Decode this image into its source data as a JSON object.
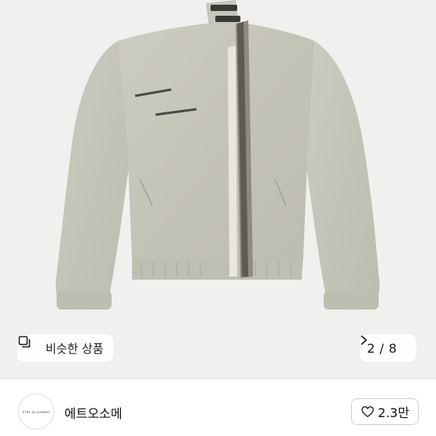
{
  "product_image": {
    "background": "#f1f0ee",
    "jacket_color": "#c9c8bd"
  },
  "similar_button": {
    "icon": "similar-products-icon",
    "label": "비슷한 상품"
  },
  "image_counter": {
    "current": "2",
    "separator": "/",
    "total": "8",
    "icon": "chevron-right-icon"
  },
  "seller": {
    "avatar_text": "ETRE AU SOMMET",
    "name": "에트오소메"
  },
  "like_button": {
    "icon": "heart-icon",
    "count": "2.3만"
  }
}
